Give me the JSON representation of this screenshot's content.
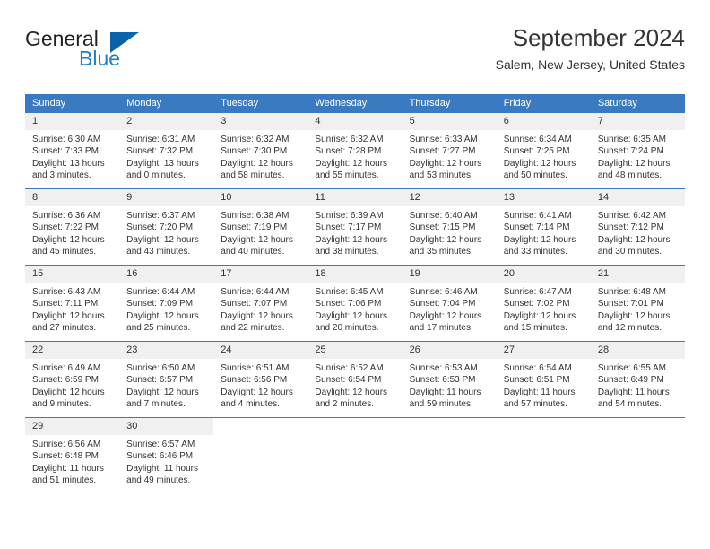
{
  "brand": {
    "name_part1": "General",
    "name_part2": "Blue"
  },
  "header": {
    "title": "September 2024",
    "location": "Salem, New Jersey, United States"
  },
  "colors": {
    "header_blue": "#3a7ac0",
    "logo_blue": "#1f7fc4",
    "daynum_band": "#f0f0f0"
  },
  "weekday_headers": [
    "Sunday",
    "Monday",
    "Tuesday",
    "Wednesday",
    "Thursday",
    "Friday",
    "Saturday"
  ],
  "weeks": [
    [
      {
        "day": "1",
        "sunrise": "Sunrise: 6:30 AM",
        "sunset": "Sunset: 7:33 PM",
        "daylight_line1": "Daylight: 13 hours",
        "daylight_line2": "and 3 minutes."
      },
      {
        "day": "2",
        "sunrise": "Sunrise: 6:31 AM",
        "sunset": "Sunset: 7:32 PM",
        "daylight_line1": "Daylight: 13 hours",
        "daylight_line2": "and 0 minutes."
      },
      {
        "day": "3",
        "sunrise": "Sunrise: 6:32 AM",
        "sunset": "Sunset: 7:30 PM",
        "daylight_line1": "Daylight: 12 hours",
        "daylight_line2": "and 58 minutes."
      },
      {
        "day": "4",
        "sunrise": "Sunrise: 6:32 AM",
        "sunset": "Sunset: 7:28 PM",
        "daylight_line1": "Daylight: 12 hours",
        "daylight_line2": "and 55 minutes."
      },
      {
        "day": "5",
        "sunrise": "Sunrise: 6:33 AM",
        "sunset": "Sunset: 7:27 PM",
        "daylight_line1": "Daylight: 12 hours",
        "daylight_line2": "and 53 minutes."
      },
      {
        "day": "6",
        "sunrise": "Sunrise: 6:34 AM",
        "sunset": "Sunset: 7:25 PM",
        "daylight_line1": "Daylight: 12 hours",
        "daylight_line2": "and 50 minutes."
      },
      {
        "day": "7",
        "sunrise": "Sunrise: 6:35 AM",
        "sunset": "Sunset: 7:24 PM",
        "daylight_line1": "Daylight: 12 hours",
        "daylight_line2": "and 48 minutes."
      }
    ],
    [
      {
        "day": "8",
        "sunrise": "Sunrise: 6:36 AM",
        "sunset": "Sunset: 7:22 PM",
        "daylight_line1": "Daylight: 12 hours",
        "daylight_line2": "and 45 minutes."
      },
      {
        "day": "9",
        "sunrise": "Sunrise: 6:37 AM",
        "sunset": "Sunset: 7:20 PM",
        "daylight_line1": "Daylight: 12 hours",
        "daylight_line2": "and 43 minutes."
      },
      {
        "day": "10",
        "sunrise": "Sunrise: 6:38 AM",
        "sunset": "Sunset: 7:19 PM",
        "daylight_line1": "Daylight: 12 hours",
        "daylight_line2": "and 40 minutes."
      },
      {
        "day": "11",
        "sunrise": "Sunrise: 6:39 AM",
        "sunset": "Sunset: 7:17 PM",
        "daylight_line1": "Daylight: 12 hours",
        "daylight_line2": "and 38 minutes."
      },
      {
        "day": "12",
        "sunrise": "Sunrise: 6:40 AM",
        "sunset": "Sunset: 7:15 PM",
        "daylight_line1": "Daylight: 12 hours",
        "daylight_line2": "and 35 minutes."
      },
      {
        "day": "13",
        "sunrise": "Sunrise: 6:41 AM",
        "sunset": "Sunset: 7:14 PM",
        "daylight_line1": "Daylight: 12 hours",
        "daylight_line2": "and 33 minutes."
      },
      {
        "day": "14",
        "sunrise": "Sunrise: 6:42 AM",
        "sunset": "Sunset: 7:12 PM",
        "daylight_line1": "Daylight: 12 hours",
        "daylight_line2": "and 30 minutes."
      }
    ],
    [
      {
        "day": "15",
        "sunrise": "Sunrise: 6:43 AM",
        "sunset": "Sunset: 7:11 PM",
        "daylight_line1": "Daylight: 12 hours",
        "daylight_line2": "and 27 minutes."
      },
      {
        "day": "16",
        "sunrise": "Sunrise: 6:44 AM",
        "sunset": "Sunset: 7:09 PM",
        "daylight_line1": "Daylight: 12 hours",
        "daylight_line2": "and 25 minutes."
      },
      {
        "day": "17",
        "sunrise": "Sunrise: 6:44 AM",
        "sunset": "Sunset: 7:07 PM",
        "daylight_line1": "Daylight: 12 hours",
        "daylight_line2": "and 22 minutes."
      },
      {
        "day": "18",
        "sunrise": "Sunrise: 6:45 AM",
        "sunset": "Sunset: 7:06 PM",
        "daylight_line1": "Daylight: 12 hours",
        "daylight_line2": "and 20 minutes."
      },
      {
        "day": "19",
        "sunrise": "Sunrise: 6:46 AM",
        "sunset": "Sunset: 7:04 PM",
        "daylight_line1": "Daylight: 12 hours",
        "daylight_line2": "and 17 minutes."
      },
      {
        "day": "20",
        "sunrise": "Sunrise: 6:47 AM",
        "sunset": "Sunset: 7:02 PM",
        "daylight_line1": "Daylight: 12 hours",
        "daylight_line2": "and 15 minutes."
      },
      {
        "day": "21",
        "sunrise": "Sunrise: 6:48 AM",
        "sunset": "Sunset: 7:01 PM",
        "daylight_line1": "Daylight: 12 hours",
        "daylight_line2": "and 12 minutes."
      }
    ],
    [
      {
        "day": "22",
        "sunrise": "Sunrise: 6:49 AM",
        "sunset": "Sunset: 6:59 PM",
        "daylight_line1": "Daylight: 12 hours",
        "daylight_line2": "and 9 minutes."
      },
      {
        "day": "23",
        "sunrise": "Sunrise: 6:50 AM",
        "sunset": "Sunset: 6:57 PM",
        "daylight_line1": "Daylight: 12 hours",
        "daylight_line2": "and 7 minutes."
      },
      {
        "day": "24",
        "sunrise": "Sunrise: 6:51 AM",
        "sunset": "Sunset: 6:56 PM",
        "daylight_line1": "Daylight: 12 hours",
        "daylight_line2": "and 4 minutes."
      },
      {
        "day": "25",
        "sunrise": "Sunrise: 6:52 AM",
        "sunset": "Sunset: 6:54 PM",
        "daylight_line1": "Daylight: 12 hours",
        "daylight_line2": "and 2 minutes."
      },
      {
        "day": "26",
        "sunrise": "Sunrise: 6:53 AM",
        "sunset": "Sunset: 6:53 PM",
        "daylight_line1": "Daylight: 11 hours",
        "daylight_line2": "and 59 minutes."
      },
      {
        "day": "27",
        "sunrise": "Sunrise: 6:54 AM",
        "sunset": "Sunset: 6:51 PM",
        "daylight_line1": "Daylight: 11 hours",
        "daylight_line2": "and 57 minutes."
      },
      {
        "day": "28",
        "sunrise": "Sunrise: 6:55 AM",
        "sunset": "Sunset: 6:49 PM",
        "daylight_line1": "Daylight: 11 hours",
        "daylight_line2": "and 54 minutes."
      }
    ],
    [
      {
        "day": "29",
        "sunrise": "Sunrise: 6:56 AM",
        "sunset": "Sunset: 6:48 PM",
        "daylight_line1": "Daylight: 11 hours",
        "daylight_line2": "and 51 minutes."
      },
      {
        "day": "30",
        "sunrise": "Sunrise: 6:57 AM",
        "sunset": "Sunset: 6:46 PM",
        "daylight_line1": "Daylight: 11 hours",
        "daylight_line2": "and 49 minutes."
      },
      {
        "day": "",
        "sunrise": "",
        "sunset": "",
        "daylight_line1": "",
        "daylight_line2": ""
      },
      {
        "day": "",
        "sunrise": "",
        "sunset": "",
        "daylight_line1": "",
        "daylight_line2": ""
      },
      {
        "day": "",
        "sunrise": "",
        "sunset": "",
        "daylight_line1": "",
        "daylight_line2": ""
      },
      {
        "day": "",
        "sunrise": "",
        "sunset": "",
        "daylight_line1": "",
        "daylight_line2": ""
      },
      {
        "day": "",
        "sunrise": "",
        "sunset": "",
        "daylight_line1": "",
        "daylight_line2": ""
      }
    ]
  ]
}
